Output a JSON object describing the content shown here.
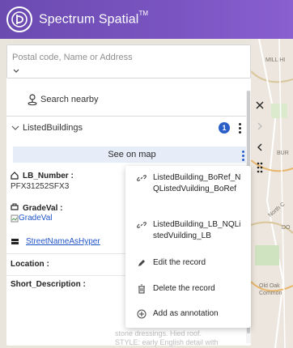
{
  "header": {
    "app_title": "Spectrum Spatial",
    "trademark": "TM"
  },
  "search": {
    "placeholder": "Postal code, Name or Address",
    "nearby_label": "Search nearby"
  },
  "layer": {
    "title": "ListedBuildings",
    "count": "1",
    "see_on_map": "See on map"
  },
  "record": {
    "lb_number_label": "LB_Number :",
    "lb_number_value": "PFX31252SFX3",
    "gradeval_label": "GradeVal :",
    "gradeval_alt": "GradeVal",
    "street_link": "StreetNameAsHyper",
    "location_label": "Location :",
    "short_desc_label": "Short_Description :",
    "tail_text_1": "stone dressings. Hied roof.",
    "tail_text_2": "STYLE: early English detail with"
  },
  "menu": {
    "items": [
      {
        "label": "ListedBuilding_BoRef_NQListedVuilding_BoRef",
        "icon": "link-icon"
      },
      {
        "label": "ListedBuilding_LB_NQListedVuilding_LB",
        "icon": "link-icon"
      },
      {
        "label": "Edit the record",
        "icon": "pencil-icon"
      },
      {
        "label": "Delete the record",
        "icon": "trash-icon"
      },
      {
        "label": "Add as annotation",
        "icon": "plus-circle-icon"
      }
    ]
  },
  "map_labels": {
    "mill_hill": "MILL HI",
    "bur": "BUR",
    "old_oak": "Old Oak",
    "common": "Common",
    "north_circular": "North C",
    "do": "DO"
  },
  "colors": {
    "header_start": "#6b4bb0",
    "header_end": "#8a5fd0",
    "badge": "#2a5fc8",
    "link": "#2054c8",
    "see_on_map_bg": "#e6ecf8"
  }
}
